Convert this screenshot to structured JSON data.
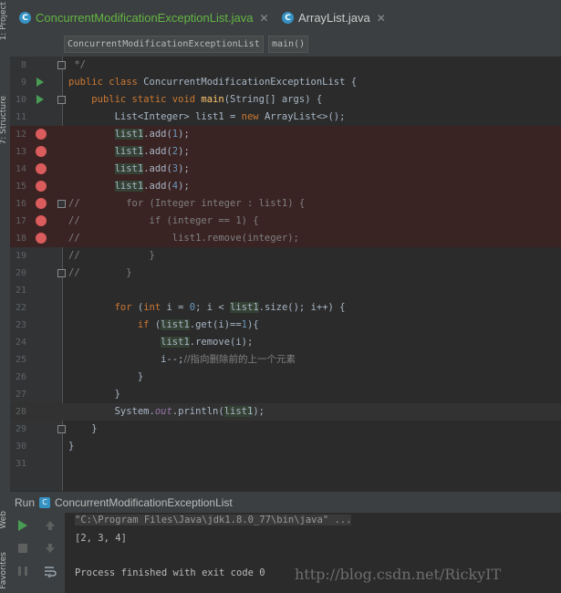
{
  "left_strip": {
    "project_label": "1: Project",
    "structure_label": "7: Structure",
    "web_label": "Web",
    "favorites_label": "Favorites"
  },
  "tabs": [
    {
      "label": "ConcurrentModificationExceptionList.java",
      "active": true,
      "icon": "class-c-icon",
      "color": "#62b543"
    },
    {
      "label": "ArrayList.java",
      "active": false,
      "icon": "class-c-icon",
      "color": "#cccccc"
    }
  ],
  "breadcrumb": {
    "class_name": "ConcurrentModificationExceptionList",
    "method_name": "main()"
  },
  "editor": {
    "lines": [
      {
        "num": "8",
        "text": " */"
      },
      {
        "num": "9",
        "text": "public class ConcurrentModificationExceptionList {"
      },
      {
        "num": "10",
        "text": "    public static void main(String[] args) {"
      },
      {
        "num": "11",
        "text": "        List<Integer> list1 = new ArrayList<>();"
      },
      {
        "num": "12",
        "text": "        list1.add(1);"
      },
      {
        "num": "13",
        "text": "        list1.add(2);"
      },
      {
        "num": "14",
        "text": "        list1.add(3);"
      },
      {
        "num": "15",
        "text": "        list1.add(4);"
      },
      {
        "num": "16",
        "text": "//        for (Integer integer : list1) {"
      },
      {
        "num": "17",
        "text": "//            if (integer == 1) {"
      },
      {
        "num": "18",
        "text": "//                list1.remove(integer);"
      },
      {
        "num": "19",
        "text": "//            }"
      },
      {
        "num": "20",
        "text": "//        }"
      },
      {
        "num": "21",
        "text": ""
      },
      {
        "num": "22",
        "text": "        for (int i = 0; i < list1.size(); i++) {"
      },
      {
        "num": "23",
        "text": "            if (list1.get(i)==1){"
      },
      {
        "num": "24",
        "text": "                list1.remove(i);"
      },
      {
        "num": "25",
        "text": "                i--;//指向删除前的上一个元素"
      },
      {
        "num": "26",
        "text": "            }"
      },
      {
        "num": "27",
        "text": "        }"
      },
      {
        "num": "28",
        "text": "        System.out.println(list1);"
      },
      {
        "num": "29",
        "text": "    }"
      },
      {
        "num": "30",
        "text": "}"
      },
      {
        "num": "31",
        "text": ""
      }
    ]
  },
  "run_panel": {
    "run_label": "Run",
    "config_name": "ConcurrentModificationExceptionList",
    "command_line": "\"C:\\Program Files\\Java\\jdk1.8.0_77\\bin\\java\" ...",
    "output_line": "[2, 3, 4]",
    "finish_line": "Process finished with exit code 0"
  },
  "watermark": "http://blog.csdn.net/RickyIT",
  "colors": {
    "keyword": "#cc7832",
    "method": "#ffc66d",
    "comment": "#808080",
    "number": "#6897bb",
    "breakpoint": "#db5c5c",
    "run": "#499c54"
  }
}
